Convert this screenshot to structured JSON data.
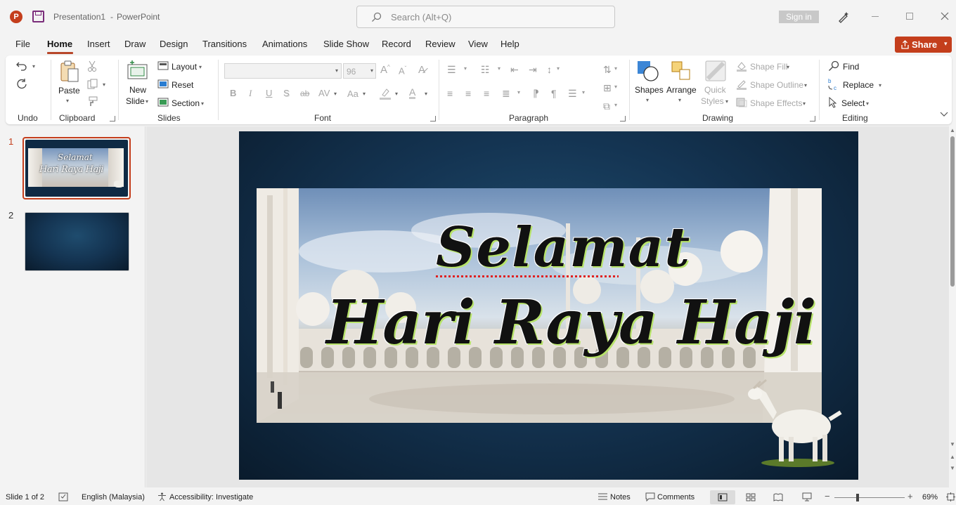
{
  "app": {
    "logo_letter": "P",
    "doc_title": "Presentation1",
    "separator": "-",
    "app_name": "PowerPoint",
    "search_placeholder": "Search (Alt+Q)",
    "sign_in": "Sign in",
    "share": "Share"
  },
  "tabs": [
    "File",
    "Home",
    "Insert",
    "Draw",
    "Design",
    "Transitions",
    "Animations",
    "Slide Show",
    "Record",
    "Review",
    "View",
    "Help"
  ],
  "ribbon": {
    "undo_group": "Undo",
    "clipboard": {
      "label": "Clipboard",
      "paste": "Paste"
    },
    "slides": {
      "label": "Slides",
      "new_slide_1": "New",
      "new_slide_2": "Slide",
      "layout": "Layout",
      "reset": "Reset",
      "section": "Section"
    },
    "font": {
      "label": "Font",
      "size": "96",
      "bold": "B",
      "italic": "I",
      "underline": "U",
      "shadow": "S",
      "strike": "ab",
      "spacing": "AV",
      "case": "Aa",
      "color_a": "A"
    },
    "paragraph": {
      "label": "Paragraph"
    },
    "drawing": {
      "label": "Drawing",
      "shapes": "Shapes",
      "arrange": "Arrange",
      "quick_styles_1": "Quick",
      "quick_styles_2": "Styles",
      "shape_fill": "Shape Fill",
      "shape_outline": "Shape Outline",
      "shape_effects": "Shape Effects"
    },
    "editing": {
      "label": "Editing",
      "find": "Find",
      "replace": "Replace",
      "select": "Select"
    }
  },
  "thumbnails": [
    {
      "number": "1",
      "line1": "Selamat",
      "line2": "Hari Raya Haji"
    },
    {
      "number": "2"
    }
  ],
  "slide": {
    "line1": "Selamat",
    "line2": "Hari Raya Haji"
  },
  "status": {
    "slide_info": "Slide 1 of 2",
    "language": "English (Malaysia)",
    "accessibility": "Accessibility: Investigate",
    "notes": "Notes",
    "comments": "Comments",
    "zoom": "69%"
  },
  "colors": {
    "accent": "#b7472a",
    "share": "#c43e1c",
    "ribbon_bg": "#ffffff",
    "slide_bg": "#143452",
    "title_glow": "#b7e36a"
  }
}
